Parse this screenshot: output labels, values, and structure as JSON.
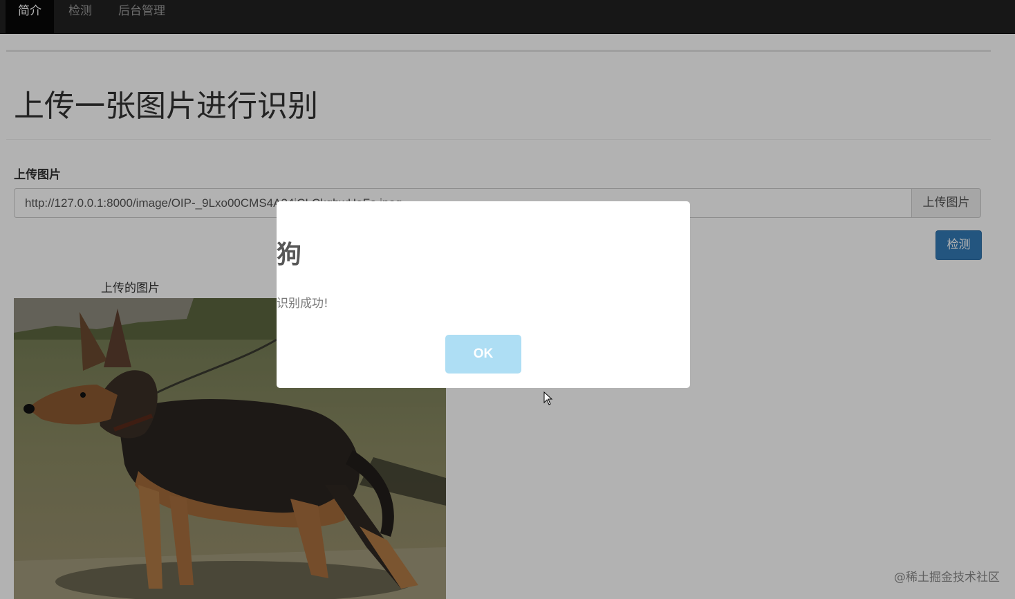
{
  "navbar": {
    "items": [
      {
        "label": "简介",
        "active": true
      },
      {
        "label": "检测",
        "active": false
      },
      {
        "label": "后台管理",
        "active": false
      }
    ]
  },
  "main": {
    "title": "上传一张图片进行识别",
    "upload_label": "上传图片",
    "url_value": "http://127.0.0.1:8000/image/OIP-_9Lxo00CMS4A34iCLCkqbwHaFe.jpeg",
    "upload_button_label": "上传图片",
    "detect_button_label": "检测",
    "image_caption": "上传的图片"
  },
  "alert": {
    "title": "狗",
    "text": "识别成功!",
    "ok_label": "OK"
  },
  "watermark": "@稀土掘金技术社区",
  "colors": {
    "navbar": "#222222",
    "primary": "#337ab7",
    "ok_button": "#aedef4",
    "overlay": "rgba(0,0,0,0.3)"
  }
}
